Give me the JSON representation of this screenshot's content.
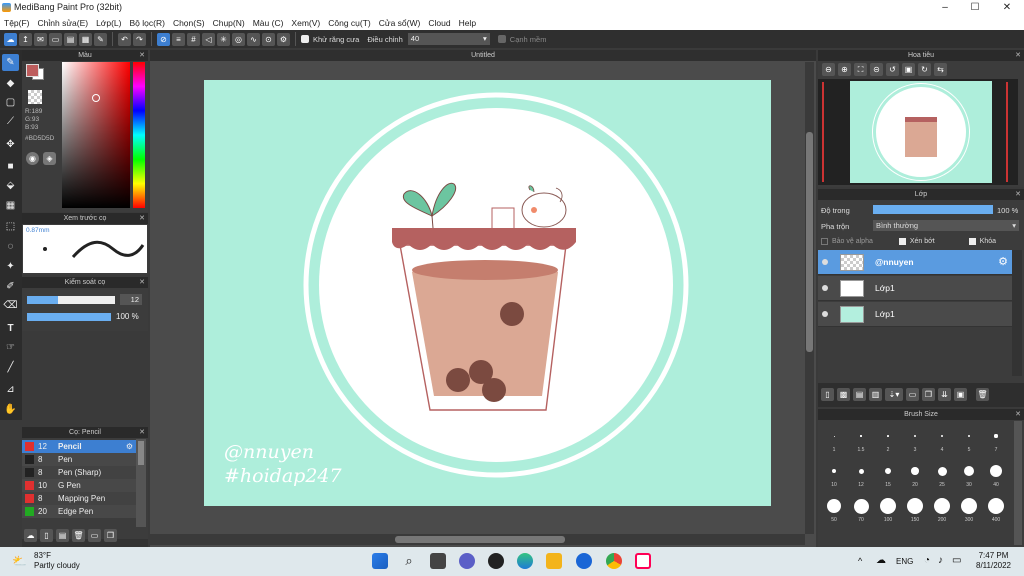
{
  "window": {
    "title": "MediBang Paint Pro (32bit)",
    "minimize": "–",
    "maximize": "☐",
    "close": "✕"
  },
  "menu": [
    "Tệp(F)",
    "Chỉnh sửa(E)",
    "Lớp(L)",
    "Bộ lọc(R)",
    "Chọn(S)",
    "Chụp(N)",
    "Màu (C)",
    "Xem(V)",
    "Công cụ(T)",
    "Cửa sổ(W)",
    "Cloud",
    "Help"
  ],
  "toolbar": {
    "antialias_label": "Khử răng cưa",
    "adjust_label": "Điều chỉnh",
    "adjust_value": "40",
    "smooth_label": "Cạnh mềm"
  },
  "color_panel": {
    "title": "Màu",
    "r": "R:189",
    "g": "G:93",
    "b": "B:93",
    "hex": "#BD5D5D",
    "fg": "#bd5d5d"
  },
  "brush_preview": {
    "title": "Xem trước cọ",
    "size": "0.87mm"
  },
  "brush_control": {
    "title": "Kiểm soát cọ",
    "size": "12",
    "opacity": "100 %",
    "size_fill": 0.35,
    "opacity_fill": 1.0
  },
  "brush_panel": {
    "title": "Cọ: Pencil",
    "items": [
      {
        "size": "12",
        "name": "Pencil",
        "color": "#e03030",
        "selected": true
      },
      {
        "size": "8",
        "name": "Pen",
        "color": "#222222"
      },
      {
        "size": "8",
        "name": "Pen (Sharp)",
        "color": "#222222"
      },
      {
        "size": "10",
        "name": "G Pen",
        "color": "#e03030"
      },
      {
        "size": "8",
        "name": "Mapping Pen",
        "color": "#e03030"
      },
      {
        "size": "20",
        "name": "Edge Pen",
        "color": "#22aa22"
      }
    ]
  },
  "canvas": {
    "title": "Untitled",
    "watermark_line1": "@nnuyen",
    "watermark_line2": "#hoidap247"
  },
  "navigator": {
    "title": "Hoa tiêu"
  },
  "layer_panel": {
    "title": "Lớp",
    "opacity_label": "Độ trong",
    "opacity_value": "100 %",
    "blend_label": "Pha trộn",
    "blend_value": "Bình thường",
    "protect_alpha": "Bảo vệ alpha",
    "clipping": "Xén bớt",
    "lock": "Khóa",
    "layers": [
      {
        "name": "@nnuyen",
        "selected": true
      },
      {
        "name": "Lớp1"
      },
      {
        "name": "Lớp1"
      }
    ]
  },
  "brush_size": {
    "title": "Brush Size",
    "sizes": [
      "1",
      "1.5",
      "2",
      "3",
      "4",
      "5",
      "7",
      "10",
      "12",
      "15",
      "20",
      "25",
      "30",
      "40",
      "50",
      "70",
      "100",
      "150",
      "200",
      "300",
      "400"
    ]
  },
  "taskbar": {
    "temp": "83°F",
    "weather": "Partly cloudy",
    "lang": "ENG",
    "time": "7:47 PM",
    "date": "8/11/2022"
  },
  "colors": {
    "accent": "#3d7fd1",
    "canvas_bg": "#aeeedb",
    "cup_top": "#b56160"
  }
}
